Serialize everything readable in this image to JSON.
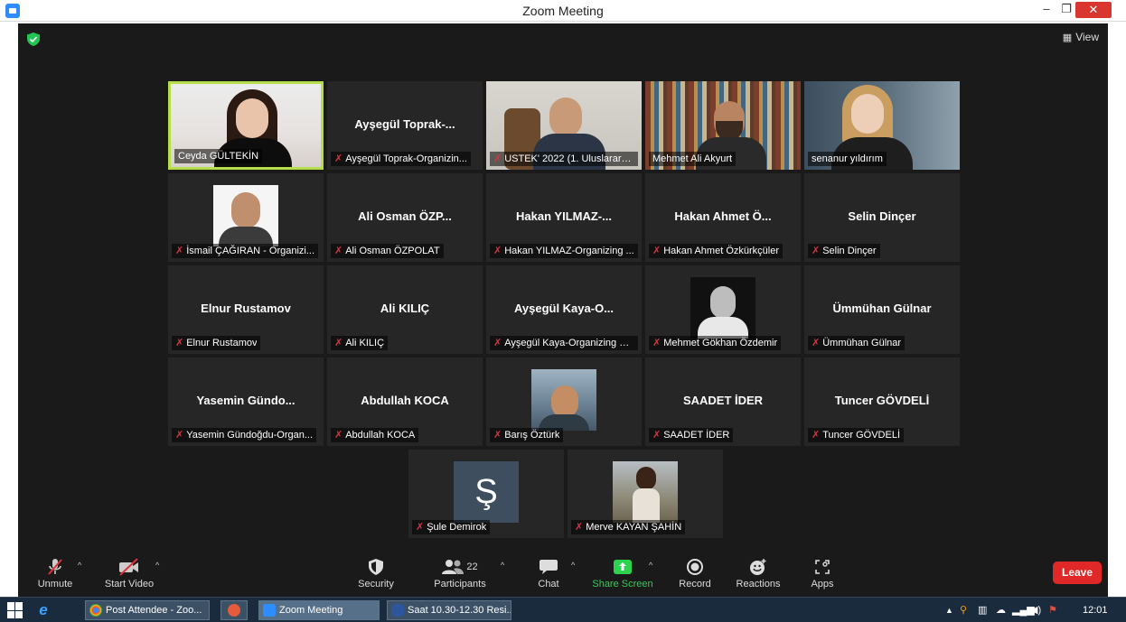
{
  "window": {
    "title": "Zoom Meeting",
    "min_glyph": "–",
    "max_glyph": "❐",
    "close_glyph": "✕"
  },
  "meeting": {
    "view_label": "View"
  },
  "tiles": [
    {
      "center": "",
      "tag": "Ceyda GÜLTEKİN",
      "muted": false,
      "video": "ceyda",
      "active": true
    },
    {
      "center": "Ayşegül  Toprak-...",
      "tag": "Ayşegül Toprak-Organizin...",
      "muted": true
    },
    {
      "center": "",
      "tag": "USTEK' 2022 (1. Uluslarara...",
      "muted": true,
      "video": "ustek"
    },
    {
      "center": "",
      "tag": "Mehmet Ali Akyurt",
      "muted": false,
      "video": "mehmet"
    },
    {
      "center": "",
      "tag": "senanur yıldırım",
      "muted": false,
      "video": "senanur"
    },
    {
      "center": "",
      "tag": "İsmail ÇAĞIRAN - Organizi...",
      "muted": true,
      "photo": "ismail"
    },
    {
      "center": "Ali Osman ÖZP...",
      "tag": "Ali Osman ÖZPOLAT",
      "muted": true
    },
    {
      "center": "Hakan  YILMAZ-...",
      "tag": "Hakan YILMAZ-Organizing ...",
      "muted": true
    },
    {
      "center": "Hakan Ahmet Ö...",
      "tag": "Hakan Ahmet Özkürkçüler",
      "muted": true
    },
    {
      "center": "Selin Dinçer",
      "tag": "Selin Dinçer",
      "muted": true
    },
    {
      "center": "Elnur Rustamov",
      "tag": "Elnur Rustamov",
      "muted": true
    },
    {
      "center": "Ali KILIÇ",
      "tag": "Ali KILIÇ",
      "muted": true
    },
    {
      "center": "Ayşegül  Kaya-O...",
      "tag": "Ayşegül Kaya-Organizing C...",
      "muted": true
    },
    {
      "center": "",
      "tag": "Mehmet Gökhan Özdemir",
      "muted": true,
      "photo": "gokhan"
    },
    {
      "center": "Ümmühan Gülnar",
      "tag": "Ümmühan Gülnar",
      "muted": true
    },
    {
      "center": "Yasemin  Gündo...",
      "tag": "Yasemin Gündoğdu-Organ...",
      "muted": true
    },
    {
      "center": "Abdullah KOCA",
      "tag": "Abdullah KOCA",
      "muted": true
    },
    {
      "center": "",
      "tag": "Barış Öztürk",
      "muted": true,
      "photo": "baris"
    },
    {
      "center": "SAADET İDER",
      "tag": "SAADET İDER",
      "muted": true
    },
    {
      "center": "Tuncer GÖVDELİ",
      "tag": "Tuncer GÖVDELİ",
      "muted": true
    },
    {
      "center": "",
      "tag": "Şule Demirok",
      "muted": true,
      "photo": "sule",
      "photo_text": "Ş"
    },
    {
      "center": "",
      "tag": "Merve KAYAN ŞAHİN",
      "muted": true,
      "photo": "merve"
    }
  ],
  "toolbar": {
    "unmute": "Unmute",
    "start_video": "Start Video",
    "security": "Security",
    "participants": "Participants",
    "participants_count": "22",
    "chat": "Chat",
    "share_screen": "Share Screen",
    "record": "Record",
    "reactions": "Reactions",
    "apps": "Apps",
    "leave": "Leave"
  },
  "taskbar": {
    "items": [
      "Post Attendee - Zoo...",
      "Zoom Meeting",
      "Saat 10.30-12.30 Resi..."
    ],
    "time": "12:01"
  },
  "colors": {
    "accent_active": "#b6dd4a",
    "muted_mic": "#e0313b",
    "leave": "#e02828",
    "share": "#2bd34e"
  }
}
